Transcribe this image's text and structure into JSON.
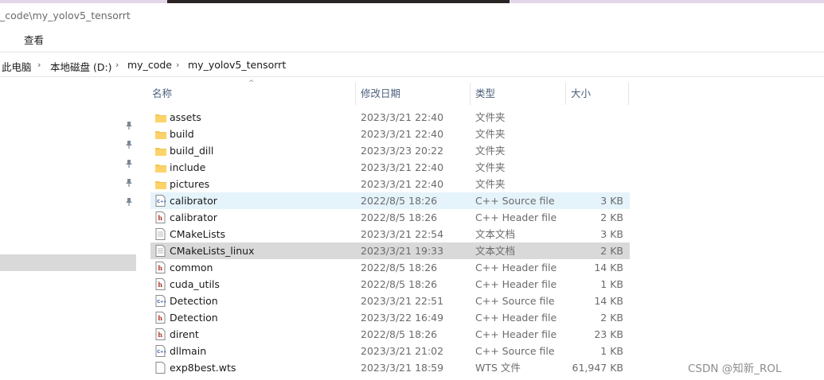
{
  "window": {
    "title": "_code\\my_yolov5_tensorrt"
  },
  "ribbon": {
    "tab_cut": "Ⅰ",
    "tab_view": "查看"
  },
  "breadcrumb": [
    "此电脑",
    "本地磁盘 (D:)",
    "my_code",
    "my_yolov5_tensorrt"
  ],
  "columns": {
    "name": "名称",
    "date": "修改日期",
    "type": "类型",
    "size": "大小"
  },
  "files": [
    {
      "name": "assets",
      "date": "2023/3/21 22:40",
      "type": "文件夹",
      "size": "",
      "icon": "folder-icon",
      "state": ""
    },
    {
      "name": "build",
      "date": "2023/3/21 22:40",
      "type": "文件夹",
      "size": "",
      "icon": "folder-icon",
      "state": ""
    },
    {
      "name": "build_dill",
      "date": "2023/3/23 20:22",
      "type": "文件夹",
      "size": "",
      "icon": "folder-icon",
      "state": ""
    },
    {
      "name": "include",
      "date": "2023/3/21 22:40",
      "type": "文件夹",
      "size": "",
      "icon": "folder-icon",
      "state": ""
    },
    {
      "name": "pictures",
      "date": "2023/3/21 22:40",
      "type": "文件夹",
      "size": "",
      "icon": "folder-icon",
      "state": ""
    },
    {
      "name": "calibrator",
      "date": "2022/8/5 18:26",
      "type": "C++ Source file",
      "size": "3 KB",
      "icon": "cpp-source-icon",
      "state": "hover"
    },
    {
      "name": "calibrator",
      "date": "2022/8/5 18:26",
      "type": "C++ Header file",
      "size": "2 KB",
      "icon": "cpp-header-icon",
      "state": ""
    },
    {
      "name": "CMakeLists",
      "date": "2023/3/21 22:54",
      "type": "文本文档",
      "size": "3 KB",
      "icon": "text-file-icon",
      "state": ""
    },
    {
      "name": "CMakeLists_linux",
      "date": "2023/3/21 19:33",
      "type": "文本文档",
      "size": "2 KB",
      "icon": "text-file-icon",
      "state": "selected"
    },
    {
      "name": "common",
      "date": "2022/8/5 18:26",
      "type": "C++ Header file",
      "size": "14 KB",
      "icon": "cpp-header-icon",
      "state": ""
    },
    {
      "name": "cuda_utils",
      "date": "2022/8/5 18:26",
      "type": "C++ Header file",
      "size": "1 KB",
      "icon": "cpp-header-icon",
      "state": ""
    },
    {
      "name": "Detection",
      "date": "2023/3/21 22:51",
      "type": "C++ Source file",
      "size": "14 KB",
      "icon": "cpp-source-icon",
      "state": ""
    },
    {
      "name": "Detection",
      "date": "2023/3/22 16:49",
      "type": "C++ Header file",
      "size": "2 KB",
      "icon": "cpp-header-icon",
      "state": ""
    },
    {
      "name": "dirent",
      "date": "2022/8/5 18:26",
      "type": "C++ Header file",
      "size": "23 KB",
      "icon": "cpp-header-icon",
      "state": ""
    },
    {
      "name": "dllmain",
      "date": "2023/3/21 21:02",
      "type": "C++ Source file",
      "size": "1 KB",
      "icon": "cpp-source-icon",
      "state": ""
    },
    {
      "name": "exp8best.wts",
      "date": "2023/3/21 18:59",
      "type": "WTS 文件",
      "size": "61,947 KB",
      "icon": "generic-file-icon",
      "state": ""
    }
  ],
  "nav": {
    "pin_count": 5,
    "pin_icon": "pin-icon"
  },
  "watermark": "CSDN @知新_ROL"
}
